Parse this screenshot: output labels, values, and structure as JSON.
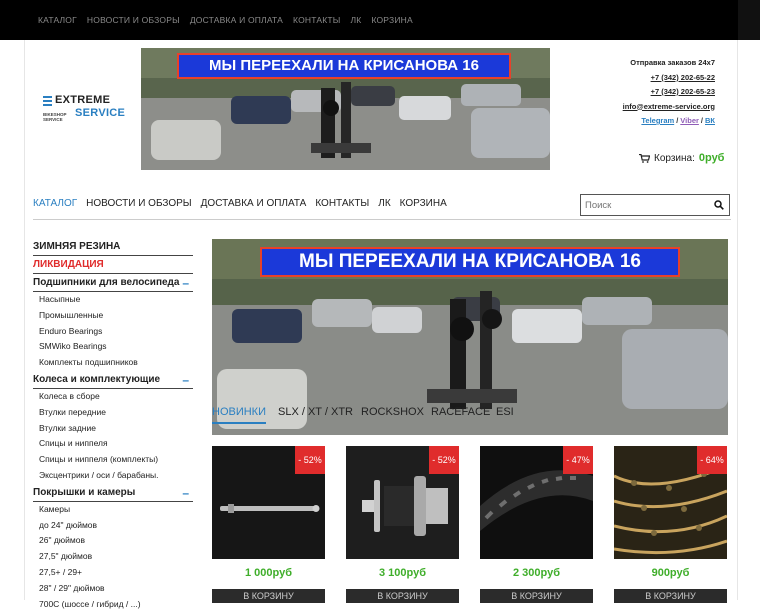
{
  "topnav": [
    "КАТАЛОГ",
    "НОВОСТИ И ОБЗОРЫ",
    "ДОСТАВКА И ОПЛАТА",
    "КОНТАКТЫ",
    "ЛК",
    "КОРЗИНА"
  ],
  "logo": {
    "word1": "EXTREME",
    "word2": "SERVICE",
    "small": "BIKESHOP\nSERVICE"
  },
  "banner": {
    "text": "МЫ ПЕРЕЕХАЛИ НА КРИСАНОВА 16"
  },
  "contact": {
    "delivery": "Отправка заказов 24х7",
    "phone1": "+7 (342) 202-65-22",
    "phone2": "+7 (342) 202-65-23",
    "email": "info@extreme-service.org",
    "telegram": "Telegram",
    "viber": "Viber",
    "vk": "ВК"
  },
  "cart": {
    "label": "Корзина:",
    "sum": "0руб"
  },
  "mainnav": [
    "КАТАЛОГ",
    "НОВОСТИ И ОБЗОРЫ",
    "ДОСТАВКА И ОПЛАТА",
    "КОНТАКТЫ",
    "ЛК",
    "КОРЗИНА"
  ],
  "search": {
    "placeholder": "Поиск"
  },
  "sidebar": [
    {
      "label": "ЗИМНЯЯ РЕЗИНА",
      "kind": "top"
    },
    {
      "label": "ЛИКВИДАЦИЯ",
      "kind": "top red"
    },
    {
      "label": "Подшипники для велосипеда",
      "kind": "top",
      "toggle": "–"
    },
    {
      "label": "Насыпные",
      "kind": "sub"
    },
    {
      "label": "Промышленные",
      "kind": "sub"
    },
    {
      "label": "Enduro Bearings",
      "kind": "sub"
    },
    {
      "label": "SMWiko Bearings",
      "kind": "sub"
    },
    {
      "label": "Комплекты подшипников",
      "kind": "sub"
    },
    {
      "label": "Колеса и комплектующие",
      "kind": "top",
      "toggle": "–"
    },
    {
      "label": "Колеса в сборе",
      "kind": "sub"
    },
    {
      "label": "Втулки передние",
      "kind": "sub"
    },
    {
      "label": "Втулки задние",
      "kind": "sub"
    },
    {
      "label": "Спицы и ниппеля",
      "kind": "sub"
    },
    {
      "label": "Спицы и ниппеля (комплекты)",
      "kind": "sub"
    },
    {
      "label": "Эксцентрики / оси / барабаны.",
      "kind": "sub"
    },
    {
      "label": "Покрышки и камеры",
      "kind": "top",
      "toggle": "–"
    },
    {
      "label": "Камеры",
      "kind": "sub"
    },
    {
      "label": "до 24\" дюймов",
      "kind": "sub"
    },
    {
      "label": "26\" дюймов",
      "kind": "sub"
    },
    {
      "label": "27,5\" дюймов",
      "kind": "sub"
    },
    {
      "label": "27,5+ / 29+",
      "kind": "sub"
    },
    {
      "label": "28\" / 29\" дюймов",
      "kind": "sub"
    },
    {
      "label": "700С (шоссе / гибрид / ...)",
      "kind": "sub"
    }
  ],
  "tabs": [
    "НОВИНКИ",
    "SLX / XT / XTR",
    "ROCKSHOX",
    "RACEFACE",
    "ESI"
  ],
  "products": [
    {
      "badge": "- 52%",
      "price": "1 000руб",
      "buy": "В КОРЗИНУ",
      "image": "axle"
    },
    {
      "badge": "- 52%",
      "price": "3 100руб",
      "buy": "В КОРЗИНУ",
      "image": "hub"
    },
    {
      "badge": "- 47%",
      "price": "2 300руб",
      "buy": "В КОРЗИНУ",
      "image": "tire"
    },
    {
      "badge": "- 64%",
      "price": "900руб",
      "buy": "В КОРЗИНУ",
      "image": "chain"
    }
  ]
}
